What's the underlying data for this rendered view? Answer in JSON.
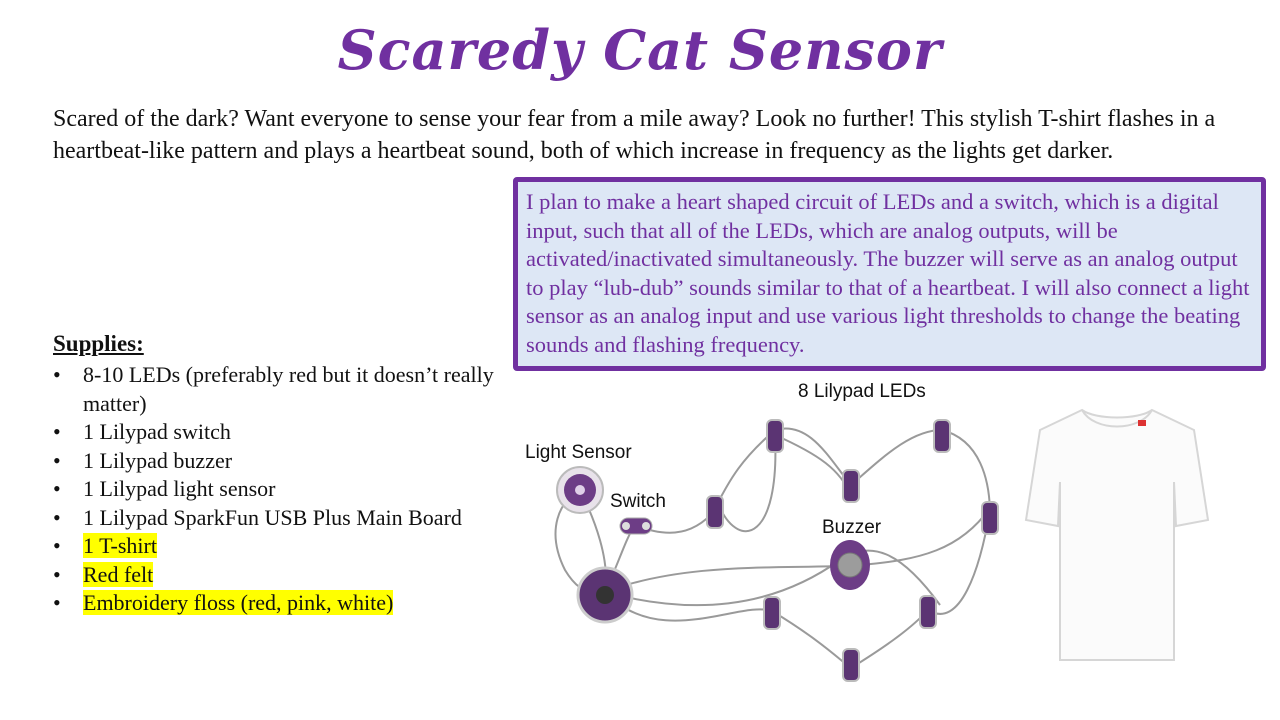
{
  "title": "Scaredy Cat Sensor",
  "intro": "Scared of the dark? Want everyone to sense your fear from a mile away? Look no further! This stylish T-shirt flashes in a heartbeat-like pattern and plays a heartbeat sound, both of which increase in frequency as the lights get darker.",
  "plan": "I plan to make a heart shaped circuit of LEDs and a switch, which is a digital input, such that all of the LEDs, which are analog outputs, will be activated/inactivated simultaneously. The buzzer will serve as an analog output to play “lub-dub” sounds similar to that of a heartbeat. I will also connect a light sensor as an analog input and use various light thresholds to change the beating sounds and flashing frequency.",
  "supplies": {
    "heading": "Supplies:",
    "items": [
      "8-10 LEDs (preferably red but it doesn’t really matter)",
      "1 Lilypad switch",
      "1 Lilypad buzzer",
      "1 Lilypad light sensor",
      "1 Lilypad SparkFun USB Plus Main Board",
      "1 T-shirt",
      "Red felt",
      "Embroidery floss (red, pink, white)"
    ]
  },
  "diagram": {
    "leds_label": "8 Lilypad LEDs",
    "light_sensor_label": "Light Sensor",
    "switch_label": "Switch",
    "buzzer_label": "Buzzer"
  },
  "colors": {
    "accent": "#7030a0",
    "plan_bg": "#dde7f5",
    "highlight": "#ffff00",
    "board": "#5b3473"
  }
}
